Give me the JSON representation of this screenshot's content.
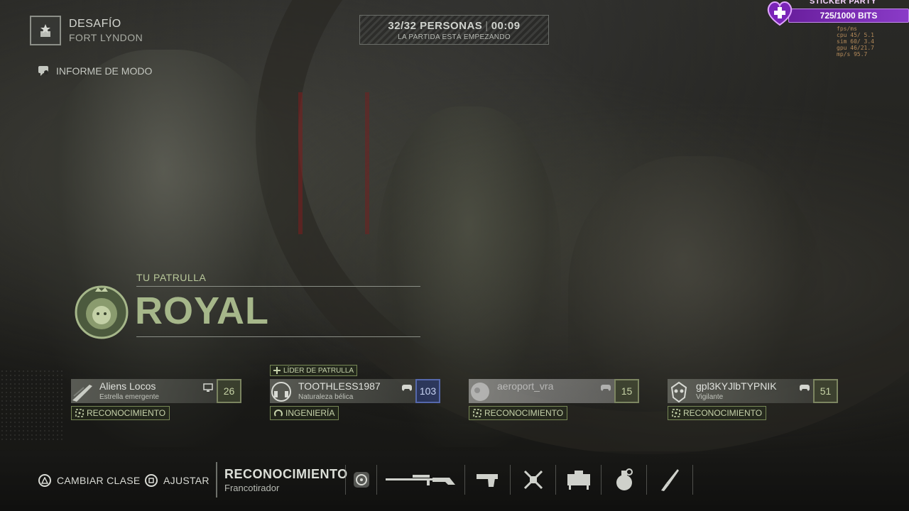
{
  "mode": {
    "icon": "skull-rank-icon",
    "title": "DESAFÍO",
    "map": "FORT LYNDON",
    "report_label": "INFORME DE MODO"
  },
  "lobby": {
    "players": "32/32 PERSONAS",
    "timer": "00:09",
    "status": "LA PARTIDA ESTÁ EMPEZANDO"
  },
  "overlay": {
    "sticker_title": "STICKER PARTY",
    "bits": "725/1000 BITS",
    "perf_lines": [
      "fps/ms",
      "cpu  45/ 5.1",
      "sim  60/ 3.4",
      "gpu  46/21.7",
      "mp/s 95.7"
    ]
  },
  "patrol": {
    "label": "TU PATRULLA",
    "name": "ROYAL",
    "emblem": "lion-emblem-icon"
  },
  "leader_badge": "LÍDER DE PATRULLA",
  "players": [
    {
      "name": "Aliens Locos",
      "title": "Estrella emergente",
      "level": "26",
      "platform": "pc-icon",
      "class": "RECONOCIMIENTO",
      "class_icon": "recon-icon"
    },
    {
      "name": "TOOTHLESS1987",
      "title": "Naturaleza bélica",
      "level": "103",
      "platform": "gamepad-icon",
      "class": "INGENIERÍA",
      "class_icon": "engineer-icon"
    },
    {
      "name": "aeroport_vra",
      "title": "",
      "level": "15",
      "platform": "gamepad-icon",
      "class": "RECONOCIMIENTO",
      "class_icon": "recon-icon"
    },
    {
      "name": "gpl3KYJlbTYPNIK",
      "title": "Vigilante",
      "level": "51",
      "platform": "gamepad-icon",
      "class": "RECONOCIMIENTO",
      "class_icon": "recon-icon"
    }
  ],
  "bottom": {
    "change_class": "CAMBIAR CLASE",
    "adjust": "AJUSTAR",
    "class_name": "RECONOCIMIENTO",
    "class_sub": "Francotirador",
    "slots": [
      "recon-gadget-icon",
      "sniper-rifle-icon",
      "pistol-icon",
      "drone-icon",
      "deployable-icon",
      "grenade-icon",
      "knife-icon"
    ]
  }
}
